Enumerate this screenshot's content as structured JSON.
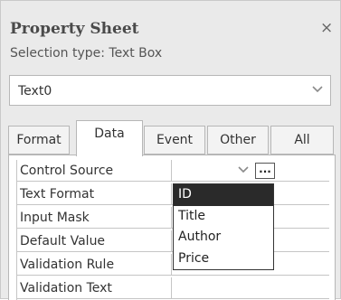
{
  "panel": {
    "title": "Property Sheet",
    "close_glyph": "×",
    "selection_type": "Selection type:  Text Box"
  },
  "object_selector": {
    "value": "Text0",
    "icon": "chevron-down-icon"
  },
  "tabs": [
    {
      "label": "Format",
      "active": false
    },
    {
      "label": "Data",
      "active": true
    },
    {
      "label": "Event",
      "active": false
    },
    {
      "label": "Other",
      "active": false
    },
    {
      "label": "All",
      "active": false
    }
  ],
  "properties": [
    {
      "label": "Control Source",
      "value": ""
    },
    {
      "label": "Text Format",
      "value": ""
    },
    {
      "label": "Input Mask",
      "value": ""
    },
    {
      "label": "Default Value",
      "value": ""
    },
    {
      "label": "Validation Rule",
      "value": ""
    },
    {
      "label": "Validation Text",
      "value": ""
    }
  ],
  "control_source_builder": "...",
  "dropdown": {
    "options": [
      "ID",
      "Title",
      "Author",
      "Price"
    ],
    "selected": "ID"
  }
}
